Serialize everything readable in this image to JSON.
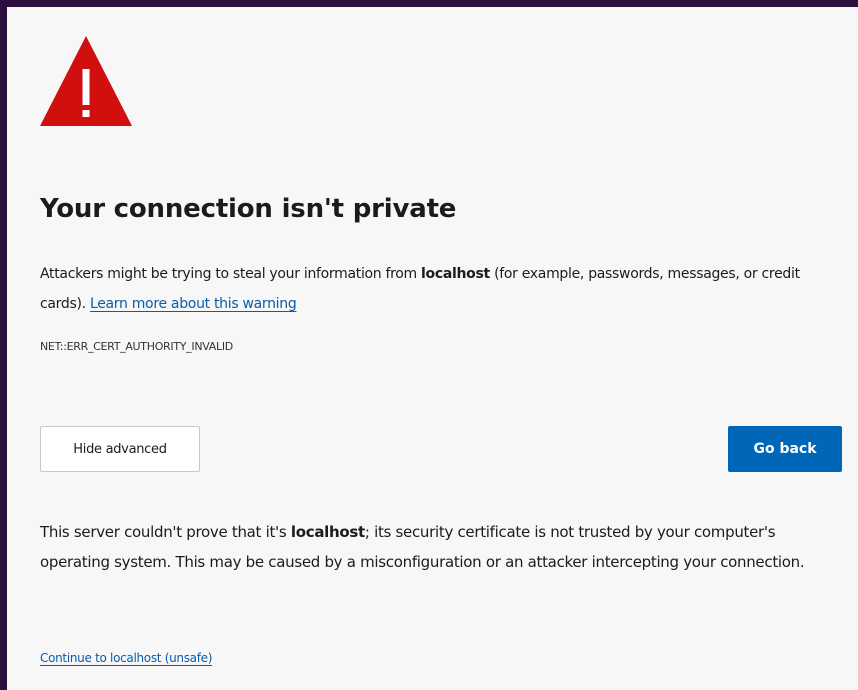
{
  "colors": {
    "background_border": "#2b0f3f",
    "page": "#f7f7f7",
    "warning_red": "#d10f0f",
    "link": "#0b5cad",
    "primary_button": "#0067b8"
  },
  "icon": {
    "name": "warning-triangle-icon",
    "glyph": "!"
  },
  "title": "Your connection isn't private",
  "summary": {
    "text_before": "Attackers might be trying to steal your information from ",
    "host": "localhost",
    "text_after": " (for example, passwords, messages, or credit cards). ",
    "learn_more_link": "Learn more about this warning"
  },
  "error_code": "NET::ERR_CERT_AUTHORITY_INVALID",
  "buttons": {
    "advanced_label": "Hide advanced",
    "back_label": "Go back"
  },
  "details": {
    "text_before": "This server couldn't prove that it's ",
    "host": "localhost",
    "text_after": "; its security certificate is not trusted by your computer's operating system. This may be caused by a misconfiguration or an attacker intercepting your connection."
  },
  "proceed_link": "Continue to localhost (unsafe)"
}
